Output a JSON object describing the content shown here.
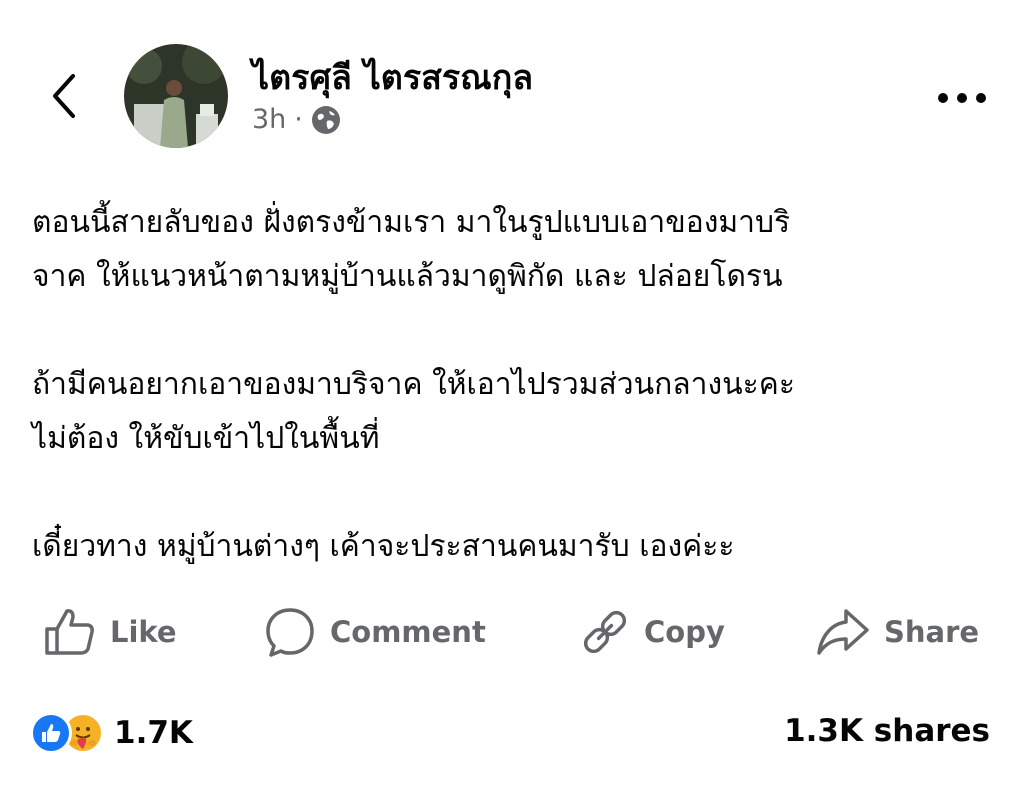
{
  "post": {
    "author_name": "ไตรศุลี ไตรสรณกุล",
    "time": "3h",
    "separator": "·",
    "privacy_icon": "globe-icon",
    "paragraphs": [
      [
        "ตอนนี้สายลับของ ฝั่งตรงข้ามเรา มาในรูปแบบเอาของมาบริ",
        "จาค ให้แนวหน้าตามหมู่บ้านแล้วมาดูพิกัด และ ปล่อยโดรน"
      ],
      [
        "ถ้ามีคนอยากเอาของมาบริจาค ให้เอาไปรวมส่วนกลางนะคะ",
        "ไม่ต้อง ให้ขับเข้าไปในพื้นที่"
      ],
      [
        "เดี๋ยวทาง หมู่บ้านต่างๆ เค้าจะประสานคนมารับ เองค่ะะ"
      ]
    ]
  },
  "actions": {
    "like": "Like",
    "comment": "Comment",
    "copy": "Copy",
    "share": "Share"
  },
  "engagement": {
    "reaction_count": "1.7K",
    "shares": "1.3K shares",
    "reaction_icons": [
      "like-reaction-icon",
      "care-reaction-icon"
    ]
  },
  "colors": {
    "text": "#050505",
    "secondary_text": "#65676b",
    "like_blue": "#1877f2",
    "care_yellow": "#f7b125"
  }
}
